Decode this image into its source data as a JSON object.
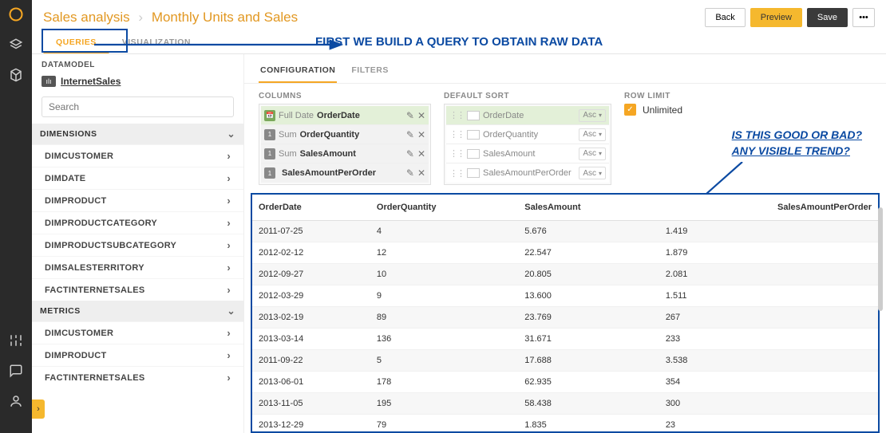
{
  "header": {
    "breadcrumb_root": "Sales analysis",
    "breadcrumb_sep": "›",
    "breadcrumb_page": "Monthly Units and Sales",
    "btn_back": "Back",
    "btn_preview": "Preview",
    "btn_save": "Save",
    "btn_more": "•••"
  },
  "annotations": {
    "top": "FIRST WE BUILD A QUERY TO OBTAIN RAW DATA",
    "right1": "IS THIS GOOD OR BAD?",
    "right2": "ANY VISIBLE TREND?"
  },
  "view_tabs": {
    "queries": "QUERIES",
    "visualization": "VISUALIZATION"
  },
  "sidebar": {
    "datamodel_label": "DATAMODEL",
    "model_name": "InternetSales",
    "search_ph": "Search",
    "dimensions_label": "DIMENSIONS",
    "dim_items": [
      "DIMCUSTOMER",
      "DIMDATE",
      "DIMPRODUCT",
      "DIMPRODUCTCATEGORY",
      "DIMPRODUCTSUBCATEGORY",
      "DIMSALESTERRITORY",
      "FACTINTERNETSALES"
    ],
    "metrics_label": "METRICS",
    "met_items": [
      "DIMCUSTOMER",
      "DIMPRODUCT",
      "FACTINTERNETSALES"
    ]
  },
  "config_tabs": {
    "configuration": "CONFIGURATION",
    "filters": "FILTERS"
  },
  "config": {
    "columns_label": "COLUMNS",
    "sort_label": "DEFAULT SORT",
    "limit_label": "ROW LIMIT",
    "unlimited": "Unlimited",
    "col_items": [
      {
        "badge": "cal",
        "agg": "Full Date",
        "fld": "OrderDate"
      },
      {
        "badge": "1",
        "agg": "Sum",
        "fld": "OrderQuantity"
      },
      {
        "badge": "1",
        "agg": "Sum",
        "fld": "SalesAmount"
      },
      {
        "badge": "1",
        "agg": "",
        "fld": "SalesAmountPerOrder"
      }
    ],
    "sort_items": [
      {
        "fld": "OrderDate",
        "dir": "Asc"
      },
      {
        "fld": "OrderQuantity",
        "dir": "Asc"
      },
      {
        "fld": "SalesAmount",
        "dir": "Asc"
      },
      {
        "fld": "SalesAmountPerOrder",
        "dir": "Asc"
      }
    ]
  },
  "table": {
    "headers": [
      "OrderDate",
      "OrderQuantity",
      "SalesAmount",
      "SalesAmountPerOrder"
    ],
    "rows": [
      [
        "2011-07-25",
        "4",
        "5.676",
        "1.419"
      ],
      [
        "2012-02-12",
        "12",
        "22.547",
        "1.879"
      ],
      [
        "2012-09-27",
        "10",
        "20.805",
        "2.081"
      ],
      [
        "2012-03-29",
        "9",
        "13.600",
        "1.511"
      ],
      [
        "2013-02-19",
        "89",
        "23.769",
        "267"
      ],
      [
        "2013-03-14",
        "136",
        "31.671",
        "233"
      ],
      [
        "2011-09-22",
        "5",
        "17.688",
        "3.538"
      ],
      [
        "2013-06-01",
        "178",
        "62.935",
        "354"
      ],
      [
        "2013-11-05",
        "195",
        "58.438",
        "300"
      ],
      [
        "2013-12-29",
        "79",
        "1.835",
        "23"
      ]
    ]
  }
}
